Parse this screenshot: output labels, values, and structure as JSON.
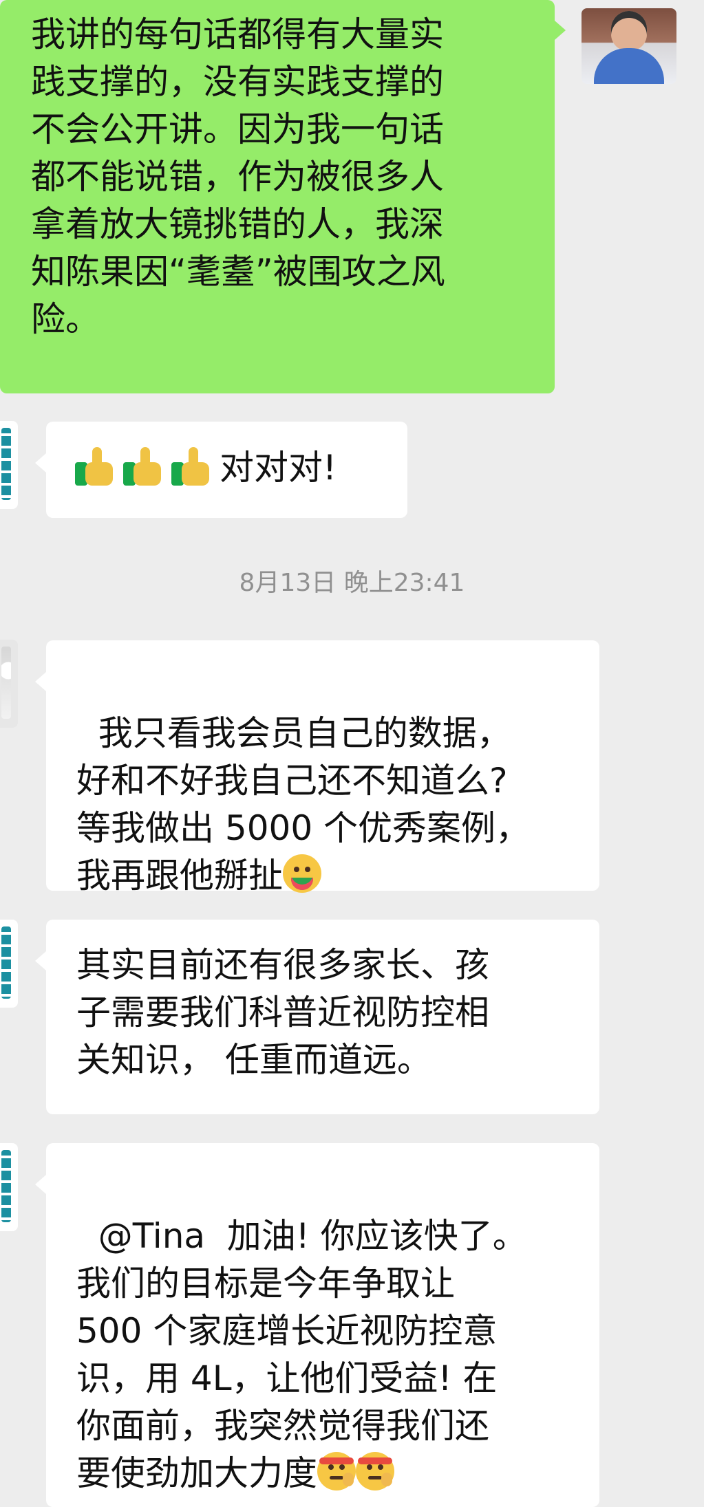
{
  "messages": [
    {
      "sender": "self",
      "text": "我讲的每句话都得有大量实\n践支撑的，没有实践支撑的\n不会公开讲。因为我一句话\n都不能说错，作为被很多人\n拿着放大镜挑错的人，我深\n知陈果因“耄耋”被围攻之风\n险。"
    },
    {
      "sender": "other",
      "text": "对对对!",
      "emoji": [
        "thumbs-up",
        "thumbs-up",
        "thumbs-up"
      ]
    },
    {
      "sender": "other",
      "text": "我只看我会员自己的数据，\n好和不好我自己还不知道么?\n等我做出 5000 个优秀案例，\n我再跟他掰扯",
      "emoji": [
        "watermelon-face"
      ]
    },
    {
      "sender": "other",
      "text": "其实目前还有很多家长、孩\n子需要我们科普近视防控相\n关知识， 任重而道远。"
    },
    {
      "sender": "other",
      "text": "@Tina  加油! 你应该快了。\n我们的目标是今年争取让\n500 个家庭增长近视防控意\n识，用 4L，让他们受益! 在\n你面前，我突然觉得我们还\n要使劲加大力度",
      "emoji": [
        "headband-face",
        "headband-face"
      ]
    }
  ],
  "timestamp": "8月13日 晚上23:41"
}
